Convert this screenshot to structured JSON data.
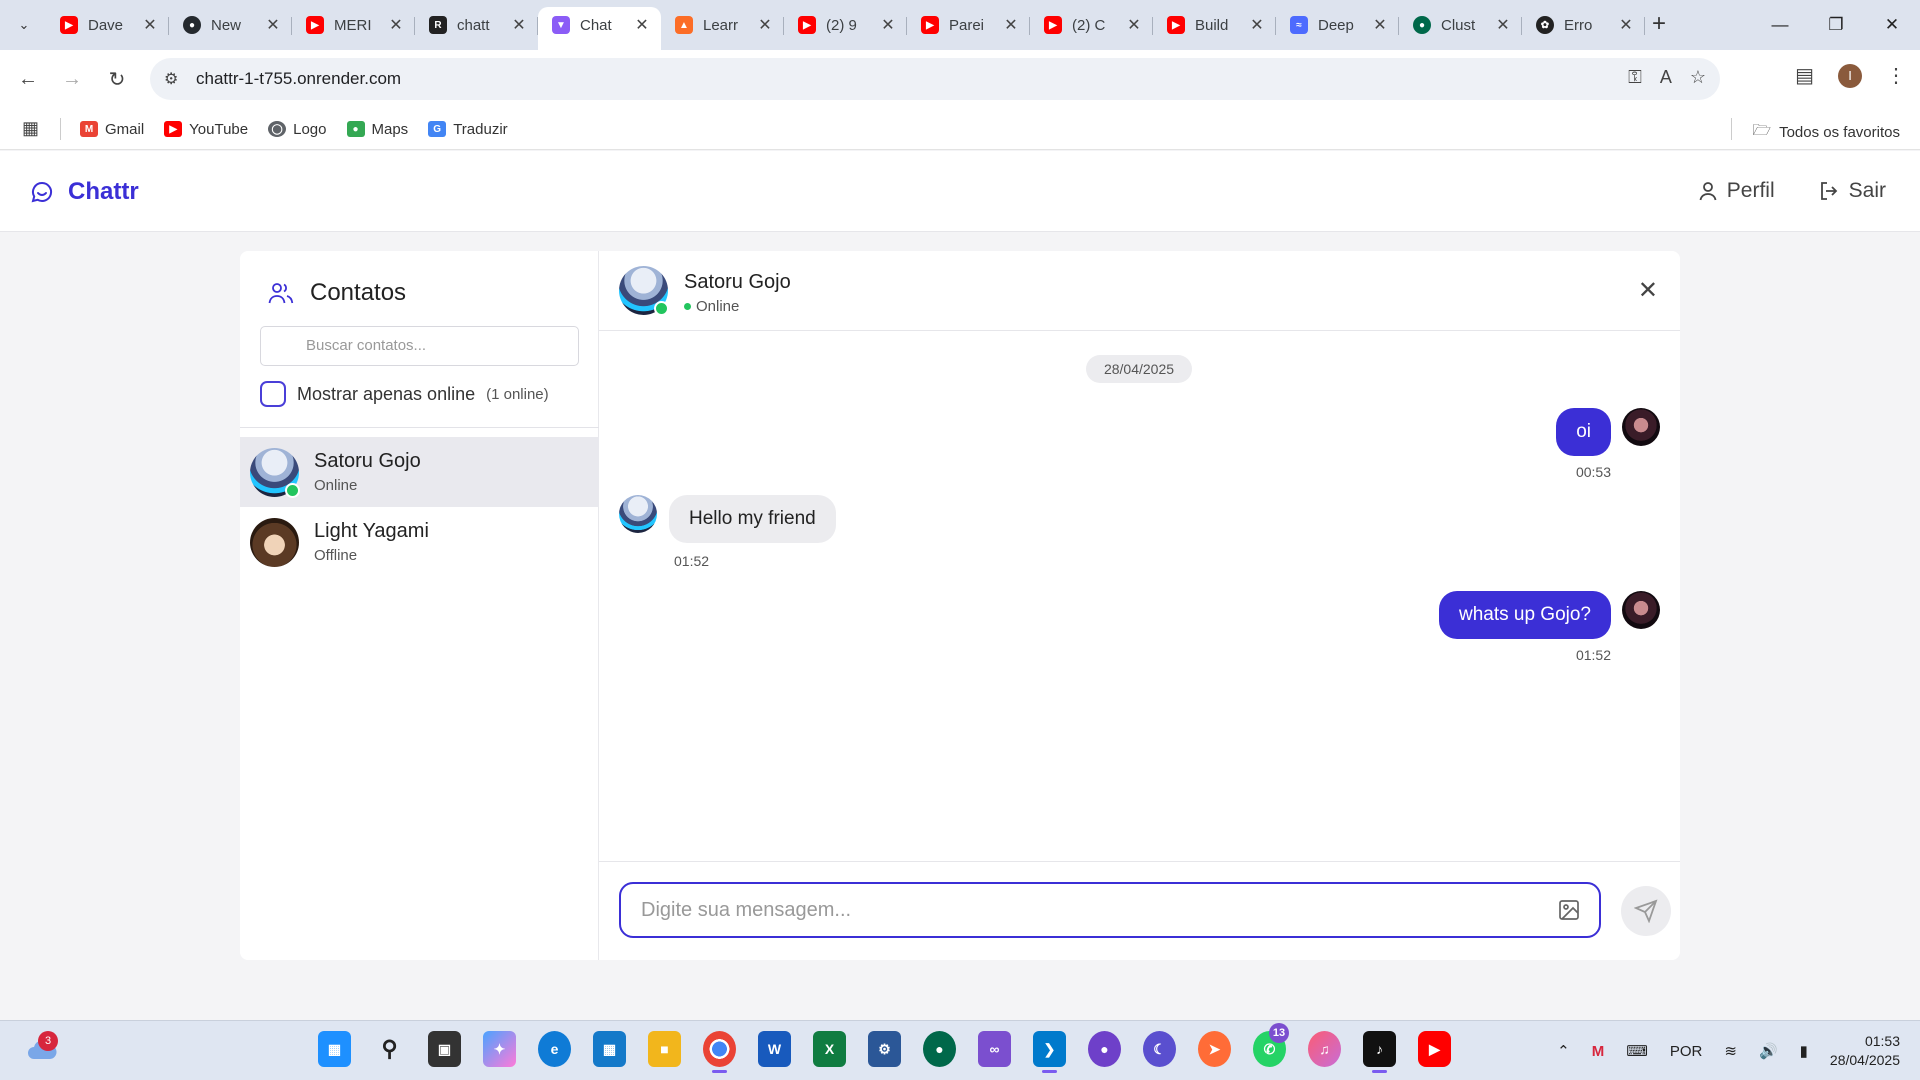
{
  "browser": {
    "tabs": [
      {
        "label": "Dave",
        "favicon": "youtube-icon",
        "color": "#ff0000"
      },
      {
        "label": "New",
        "favicon": "github-icon",
        "color": "#24292e"
      },
      {
        "label": "MERI",
        "favicon": "youtube-icon",
        "color": "#ff0000"
      },
      {
        "label": "chatt",
        "favicon": "render-icon",
        "color": "#222222"
      },
      {
        "label": "Chat",
        "favicon": "vite-icon",
        "color": "#8b5cf6",
        "active": true
      },
      {
        "label": "Learr",
        "favicon": "gitlab-icon",
        "color": "#fc6d26"
      },
      {
        "label": "(2) 9",
        "favicon": "youtube-icon",
        "color": "#ff0000"
      },
      {
        "label": "Parei",
        "favicon": "youtube-icon",
        "color": "#ff0000"
      },
      {
        "label": "(2) C",
        "favicon": "youtube-icon",
        "color": "#ff0000"
      },
      {
        "label": "Build",
        "favicon": "youtube-icon",
        "color": "#ff0000"
      },
      {
        "label": "Deep",
        "favicon": "deepseek-icon",
        "color": "#4d6bfe"
      },
      {
        "label": "Clust",
        "favicon": "mongodb-icon",
        "color": "#00684a"
      },
      {
        "label": "Erro",
        "favicon": "openai-icon",
        "color": "#222222"
      }
    ],
    "url": "chattr-1-t755.onrender.com",
    "profile_initial": "I",
    "bookmarks": [
      {
        "label": "Gmail",
        "icon": "gmail-icon",
        "color": "#ea4335"
      },
      {
        "label": "YouTube",
        "icon": "youtube-icon",
        "color": "#ff0000"
      },
      {
        "label": "Logo",
        "icon": "globe-icon",
        "color": "#5f6368"
      },
      {
        "label": "Maps",
        "icon": "maps-icon",
        "color": "#34a853"
      },
      {
        "label": "Traduzir",
        "icon": "translate-icon",
        "color": "#4285f4"
      }
    ],
    "all_bookmarks_label": "Todos os favoritos"
  },
  "app": {
    "brand": "Chattr",
    "accent": "#3b2fd6",
    "profile_label": "Perfil",
    "logout_label": "Sair"
  },
  "contacts": {
    "title": "Contatos",
    "search_placeholder": "Buscar contatos...",
    "online_filter_label": "Mostrar apenas online",
    "online_count": "(1 online)",
    "items": [
      {
        "name": "Satoru Gojo",
        "status": "Online",
        "online": true,
        "selected": true
      },
      {
        "name": "Light Yagami",
        "status": "Offline",
        "online": false,
        "selected": false
      }
    ]
  },
  "chat": {
    "contact_name": "Satoru Gojo",
    "contact_status": "Online",
    "date": "28/04/2025",
    "messages": [
      {
        "text": "oi",
        "time": "00:53",
        "outgoing": true
      },
      {
        "text": "Hello my friend",
        "time": "01:52",
        "outgoing": false
      },
      {
        "text": "whats up Gojo?",
        "time": "01:52",
        "outgoing": true
      }
    ],
    "input_placeholder": "Digite sua mensagem..."
  },
  "taskbar": {
    "weather_badge": "3",
    "whatsapp_badge": "13",
    "language": "POR",
    "time": "01:53",
    "date": "28/04/2025"
  }
}
